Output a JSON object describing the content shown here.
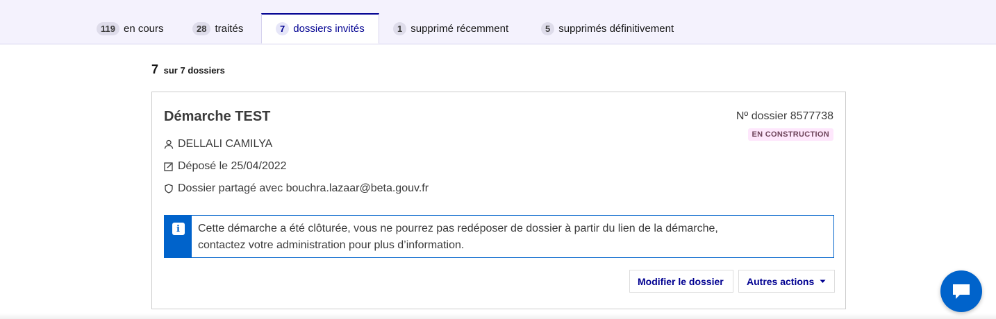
{
  "tabs": [
    {
      "count": "119",
      "label": "en cours"
    },
    {
      "count": "28",
      "label": "traités"
    },
    {
      "count": "7",
      "label": "dossiers invités"
    },
    {
      "count": "1",
      "label": "supprimé récemment"
    },
    {
      "count": "5",
      "label": "supprimés définitivement"
    }
  ],
  "results": {
    "count": "7",
    "text": "sur 7 dossiers"
  },
  "dossier": {
    "title": "Démarche TEST",
    "number": "Nº dossier 8577738",
    "status": "EN CONSTRUCTION",
    "user": "DELLALI CAMILYA",
    "deposited": "Déposé le 25/04/2022",
    "shared": "Dossier partagé avec bouchra.lazaar@beta.gouv.fr",
    "notice_line1": "Cette démarche a été clôturée, vous ne pourrez pas redéposer de dossier à partir du lien de la démarche,",
    "notice_line2": "contactez votre administration pour plus d’information.",
    "edit_label": "Modifier le dossier",
    "actions_label": "Autres actions"
  },
  "colors": {
    "accent": "#000091",
    "info": "#0063cb",
    "badge_bg": "#fee7fc"
  }
}
